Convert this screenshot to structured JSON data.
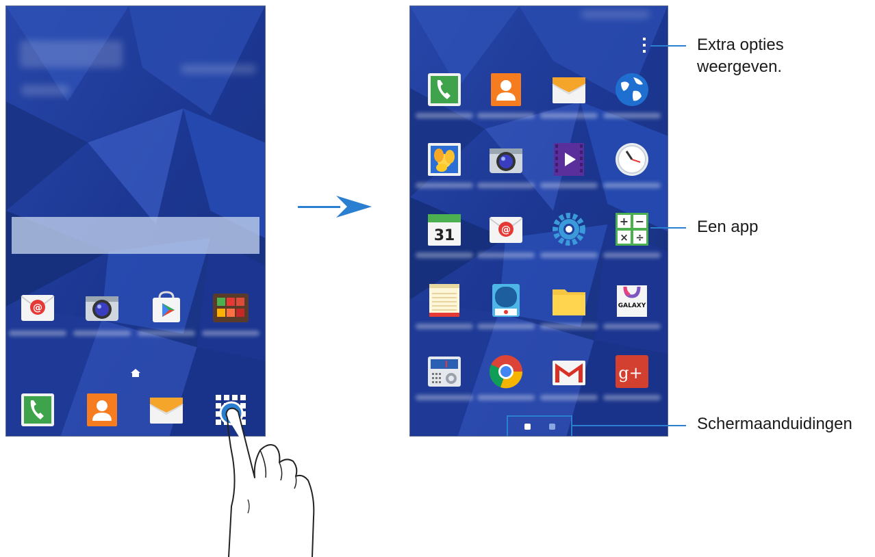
{
  "callouts": {
    "more_options": "Extra opties weergeven.",
    "an_app": "Een app",
    "screen_indicators": "Schermaanduidingen"
  },
  "icons": {
    "home_screen": [
      "email-icon",
      "camera-icon",
      "play-store-icon",
      "google-folder-icon",
      "phone-icon",
      "contacts-icon",
      "messages-icon",
      "apps-icon"
    ],
    "apps_screen": [
      "phone-icon",
      "contacts-icon",
      "messages-icon",
      "internet-icon",
      "gallery-icon",
      "camera-icon",
      "video-icon",
      "clock-icon",
      "calendar-icon",
      "email-icon",
      "settings-icon",
      "calculator-icon",
      "memo-icon",
      "voice-recorder-icon",
      "my-files-icon",
      "galaxy-apps-icon",
      "radio-icon",
      "chrome-icon",
      "gmail-icon",
      "google-plus-icon"
    ]
  },
  "app_labels": {
    "calendar_day": "31",
    "galaxy": "GALAXY",
    "gplus": "g+"
  },
  "colors": {
    "wallpaper": "#1f3f9e",
    "accent": "#2a7fd0",
    "indicator_active": "#ffffff",
    "indicator_inactive": "#8aa6e0"
  },
  "indicator": {
    "pages": 2,
    "active": 1
  }
}
